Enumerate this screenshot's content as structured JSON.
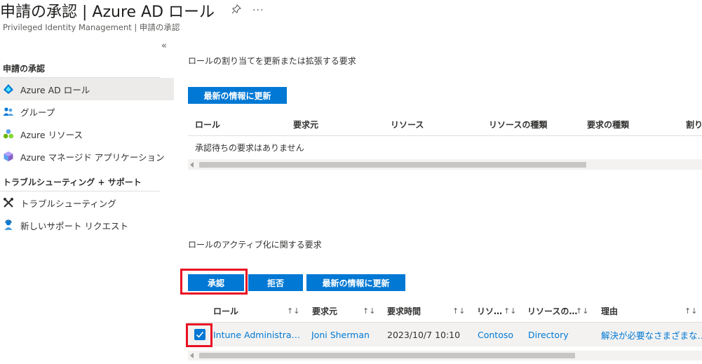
{
  "header": {
    "title": "申請の承認 | Azure AD ロール",
    "pin_glyph": "✎",
    "more_glyph": "···",
    "breadcrumb": "Privileged Identity Management | 申請の承認"
  },
  "sidebar": {
    "collapse_glyph": "«",
    "section1_title": "申請の承認",
    "items": [
      {
        "label": "Azure AD ロール",
        "icon": "azure-ad-icon"
      },
      {
        "label": "グループ",
        "icon": "group-icon"
      },
      {
        "label": "Azure リソース",
        "icon": "azure-resources-icon"
      },
      {
        "label": "Azure マネージド アプリケーション",
        "icon": "managed-app-icon"
      }
    ],
    "section2_title": "トラブルシューティング + サポート",
    "support_items": [
      {
        "label": "トラブルシューティング",
        "icon": "tools-icon"
      },
      {
        "label": "新しいサポート リクエスト",
        "icon": "support-person-icon"
      }
    ]
  },
  "renewal": {
    "label": "ロールの割り当てを更新または拡張する要求",
    "refresh_label": "最新の情報に更新",
    "columns": [
      "ロール",
      "要求元",
      "リソース",
      "リソースの種類",
      "要求の種類",
      "割り"
    ],
    "empty_message": "承認待ちの要求はありません"
  },
  "activation": {
    "label": "ロールのアクティブ化に関する要求",
    "approve_label": "承認",
    "deny_label": "拒否",
    "refresh_label": "最新の情報に更新",
    "columns": [
      "ロール",
      "要求元",
      "要求時間",
      "リソ…",
      "リソースの…",
      "理由"
    ],
    "sort_glyph": "↑↓",
    "rows": [
      {
        "checked": true,
        "role": "Intune Administra…",
        "requester": "Joni Sherman",
        "time": "2023/10/7 10:10",
        "resource": "Contoso",
        "resource_type": "Directory",
        "reason": "解決が必要なさまざまな…"
      }
    ]
  },
  "colors": {
    "accent": "#0078d4",
    "highlight": "#e81123",
    "row_bg": "#f3f2f1"
  }
}
